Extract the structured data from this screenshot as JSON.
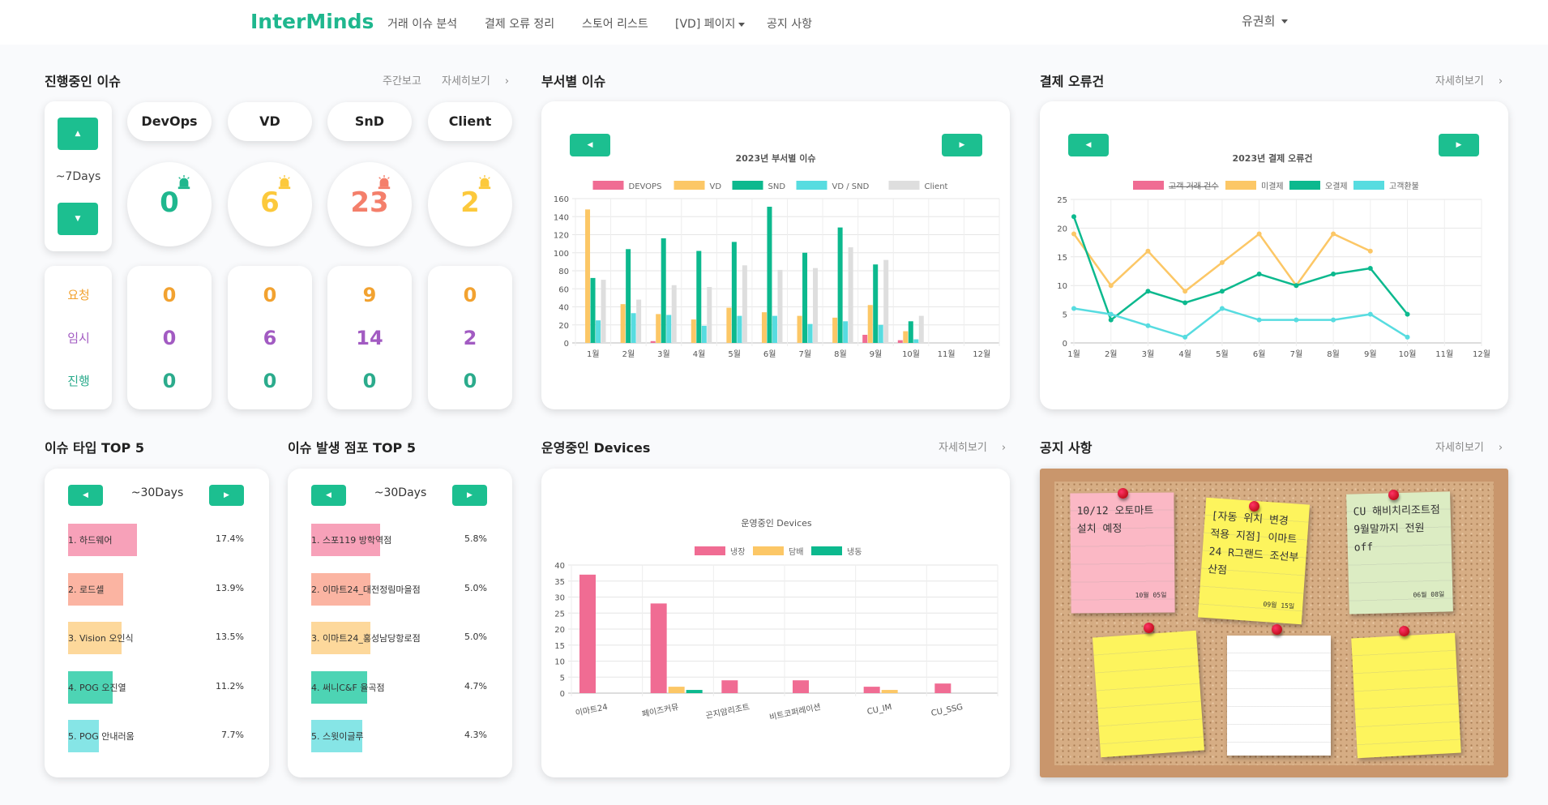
{
  "nav": {
    "brand": "InterMinds",
    "items": [
      "거래 이슈 분석",
      "결제 오류 정리",
      "스토어 리스트",
      "[VD] 페이지",
      "공지 사항"
    ],
    "user": "유권희"
  },
  "issues": {
    "title": "진행중인 이슈",
    "weekly_link": "주간보고",
    "detail_link": "자세히보기",
    "period": "~7Days",
    "departments": [
      {
        "name": "DevOps",
        "total": "0",
        "color": "#1fb78e",
        "request": "0",
        "temporary": "0",
        "progress": "0"
      },
      {
        "name": "VD",
        "total": "6",
        "color": "#fcc93c",
        "request": "0",
        "temporary": "6",
        "progress": "0"
      },
      {
        "name": "SnD",
        "total": "23",
        "color": "#f47f6b",
        "request": "9",
        "temporary": "14",
        "progress": "0"
      },
      {
        "name": "Client",
        "total": "2",
        "color": "#fcc93c",
        "request": "0",
        "temporary": "2",
        "progress": "0"
      }
    ],
    "labels": {
      "request": "요청",
      "temporary": "임시",
      "progress": "진행"
    }
  },
  "dept_chart": {
    "section_title": "부서별 이슈",
    "chart_data": {
      "type": "bar",
      "title": "2023년 부서별 이슈",
      "categories": [
        "1월",
        "2월",
        "3월",
        "4월",
        "5월",
        "6월",
        "7월",
        "8월",
        "9월",
        "10월",
        "11월",
        "12월"
      ],
      "ylim": [
        0,
        160
      ],
      "yticks": [
        0,
        20,
        40,
        60,
        80,
        100,
        120,
        140,
        160
      ],
      "series": [
        {
          "name": "DEVOPS",
          "color": "#f06c93",
          "values": [
            0,
            0,
            2,
            0,
            0,
            0,
            0,
            0,
            9,
            3,
            0,
            0
          ]
        },
        {
          "name": "VD",
          "color": "#fcc766",
          "values": [
            148,
            43,
            32,
            26,
            39,
            34,
            30,
            28,
            42,
            13,
            0,
            0
          ]
        },
        {
          "name": "SND",
          "color": "#0cb98e",
          "values": [
            72,
            104,
            116,
            102,
            112,
            151,
            100,
            128,
            87,
            24,
            0,
            0
          ]
        },
        {
          "name": "VD / SND",
          "color": "#57dce0",
          "values": [
            25,
            33,
            31,
            19,
            30,
            30,
            21,
            24,
            20,
            4,
            0,
            0
          ]
        },
        {
          "name": "Client",
          "color": "#dedede",
          "values": [
            70,
            48,
            64,
            62,
            86,
            81,
            83,
            106,
            92,
            30,
            0,
            0
          ]
        }
      ]
    }
  },
  "payment_chart": {
    "section_title": "결제 오류건",
    "detail_link": "자세히보기",
    "chart_data": {
      "type": "line",
      "title": "2023년 결제 오류건",
      "categories": [
        "1월",
        "2월",
        "3월",
        "4월",
        "5월",
        "6월",
        "7월",
        "8월",
        "9월",
        "10월",
        "11월",
        "12월"
      ],
      "ylim": [
        0,
        25
      ],
      "yticks": [
        0,
        5,
        10,
        15,
        20,
        25
      ],
      "series": [
        {
          "name": "고객 거래 건수",
          "color": "#f06c93",
          "hidden": true,
          "values": []
        },
        {
          "name": "미결제",
          "color": "#fcc766",
          "values": [
            19,
            10,
            16,
            9,
            14,
            19,
            10,
            19,
            16
          ]
        },
        {
          "name": "오결제",
          "color": "#0cb98e",
          "values": [
            22,
            4,
            9,
            7,
            9,
            12,
            10,
            12,
            13,
            5
          ]
        },
        {
          "name": "고객환불",
          "color": "#57dce0",
          "values": [
            6,
            5,
            3,
            1,
            6,
            4,
            4,
            4,
            5,
            1
          ]
        }
      ]
    }
  },
  "issue_type_top5": {
    "title": "이슈 타입 TOP 5",
    "period": "~30Days",
    "chart_data": {
      "type": "bar",
      "categories": [
        "1. 하드웨어",
        "2. 로드셀",
        "3. Vision 오인식",
        "4. POG 오진열",
        "5. POG 안내러움"
      ],
      "values": [
        17.4,
        13.9,
        13.5,
        11.2,
        7.7
      ],
      "labels": [
        "17.4%",
        "13.9%",
        "13.5%",
        "11.2%",
        "7.7%"
      ],
      "colors": [
        "#f7a1b9",
        "#fbb4a2",
        "#fdd89b",
        "#4dd4b4",
        "#86e5e6"
      ]
    }
  },
  "store_top5": {
    "title": "이슈 발생 점포 TOP 5",
    "period": "~30Days",
    "chart_data": {
      "type": "bar",
      "categories": [
        "1. 스포119 방학역점",
        "2. 이마트24_대전정림마을점",
        "3. 이마트24_홍성남당항로점",
        "4. 써니C&F 율곡점",
        "5. 스윗이글루"
      ],
      "values": [
        5.8,
        5.0,
        5.0,
        4.7,
        4.3
      ],
      "labels": [
        "5.8%",
        "5.0%",
        "5.0%",
        "4.7%",
        "4.3%"
      ],
      "colors": [
        "#f7a1b9",
        "#fbb4a2",
        "#fdd89b",
        "#4dd4b4",
        "#86e5e6"
      ]
    }
  },
  "devices_chart": {
    "section_title": "운영중인 Devices",
    "detail_link": "자세히보기",
    "chart_data": {
      "type": "bar",
      "title": "운영중인 Devices",
      "categories": [
        "이마트24",
        "페이즈커뮤",
        "곤지암리조트",
        "비트코퍼레이션",
        "CU_IM",
        "CU_SSG"
      ],
      "ylim": [
        0,
        40
      ],
      "yticks": [
        0,
        5,
        10,
        15,
        20,
        25,
        30,
        35,
        40
      ],
      "series": [
        {
          "name": "냉장",
          "color": "#f06c93",
          "values": [
            37,
            28,
            4,
            4,
            2,
            3
          ]
        },
        {
          "name": "담배",
          "color": "#fcc766",
          "values": [
            0,
            2,
            0,
            0,
            1,
            0
          ]
        },
        {
          "name": "냉동",
          "color": "#0cb98e",
          "values": [
            0,
            1,
            0,
            0,
            0,
            0
          ]
        }
      ]
    }
  },
  "notices": {
    "title": "공지 사항",
    "detail_link": "자세히보기",
    "notes": [
      {
        "text": "10/12 오토마트 설치 예정",
        "date": "10월 05일",
        "color": "#fbb8c5"
      },
      {
        "text": "[자동 위치 변경 적용 지점] 이마트24 R그랜드 조선부산점",
        "date": "09월 15일",
        "color": "#fdf45d"
      },
      {
        "text": "CU 해비치리조트점 9월말까지 전원 off",
        "date": "06월 08일",
        "color": "#dcecc3"
      },
      {
        "text": "",
        "date": "",
        "color": "#fdf45d"
      },
      {
        "text": "",
        "date": "",
        "color": "#ffffff"
      },
      {
        "text": "",
        "date": "",
        "color": "#fdf45d"
      }
    ]
  }
}
